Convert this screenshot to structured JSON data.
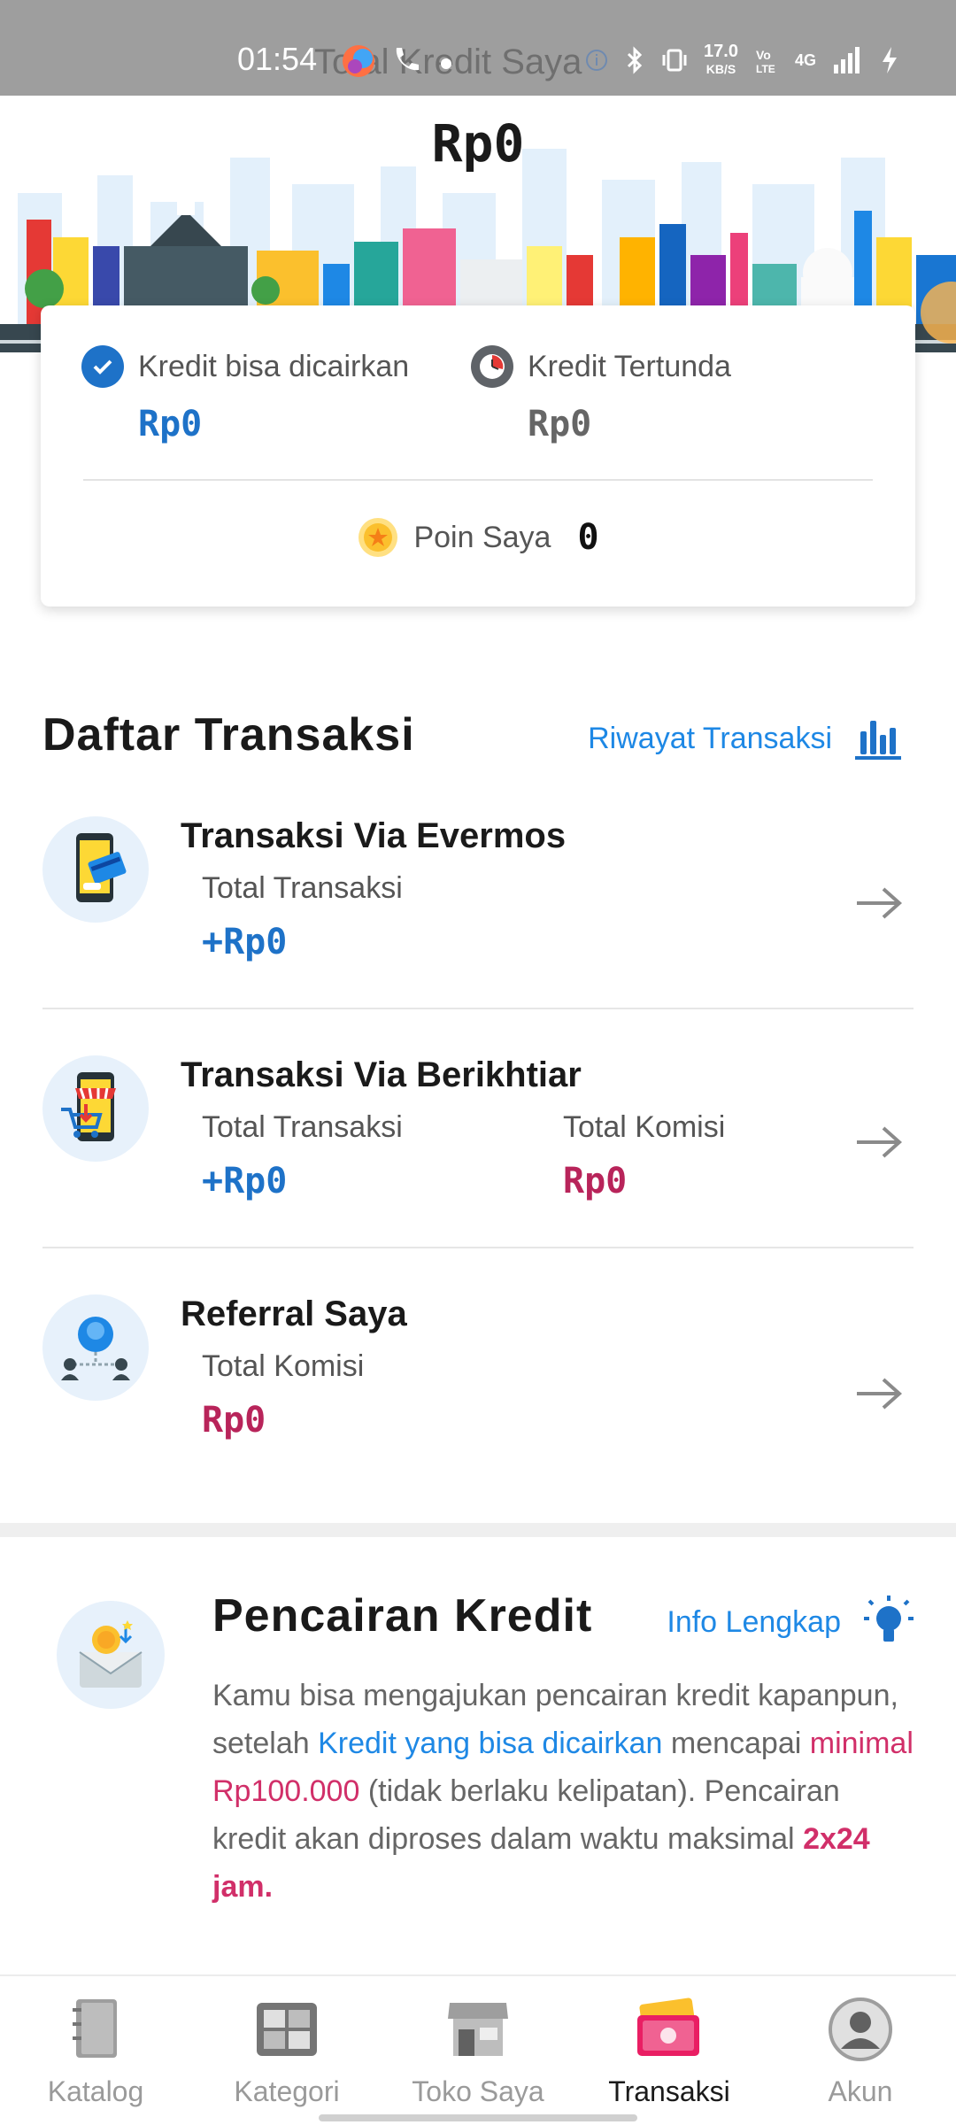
{
  "status_bar": {
    "time": "01:54",
    "background_title": "Total Kredit Saya",
    "net_speed_value": "17.0",
    "net_speed_unit": "KB/S",
    "network_type": "4G"
  },
  "header": {
    "total_credit": "Rp0"
  },
  "credit_card": {
    "withdrawable_label": "Kredit bisa dicairkan",
    "withdrawable_value": "Rp0",
    "pending_label": "Kredit Tertunda",
    "pending_value": "Rp0",
    "points_label": "Poin Saya",
    "points_value": "0"
  },
  "transactions": {
    "title": "Daftar Transaksi",
    "history_link": "Riwayat Transaksi",
    "items": [
      {
        "title": "Transaksi Via Evermos",
        "total_label": "Total Transaksi",
        "total_value": "+Rp0"
      },
      {
        "title": "Transaksi Via Berikhtiar",
        "total_label": "Total Transaksi",
        "total_value": "+Rp0",
        "commission_label": "Total Komisi",
        "commission_value": "Rp0"
      },
      {
        "title": "Referral Saya",
        "commission_label": "Total Komisi",
        "commission_value": "Rp0"
      }
    ]
  },
  "withdrawal": {
    "title": "Pencairan Kredit",
    "info_link": "Info Lengkap",
    "text_1": "Kamu bisa mengajukan pencairan kredit kapanpun, setelah ",
    "highlight_1": "Kredit yang bisa dicairkan",
    "text_2": " mencapai ",
    "highlight_2": "minimal Rp100.000",
    "text_3": " (tidak berlaku kelipatan). Pencairan kredit akan diproses dalam waktu maksimal ",
    "highlight_3": "2x24 jam."
  },
  "bottom_nav": {
    "items": [
      {
        "label": "Katalog",
        "icon": "catalog-book-icon"
      },
      {
        "label": "Kategori",
        "icon": "category-icon"
      },
      {
        "label": "Toko Saya",
        "icon": "store-icon"
      },
      {
        "label": "Transaksi",
        "icon": "transaction-wallet-icon",
        "active": true
      },
      {
        "label": "Akun",
        "icon": "account-icon"
      }
    ]
  },
  "colors": {
    "accent_blue": "#1e88e5",
    "amount_blue": "#1e72c8",
    "amount_red": "#b8245a"
  }
}
